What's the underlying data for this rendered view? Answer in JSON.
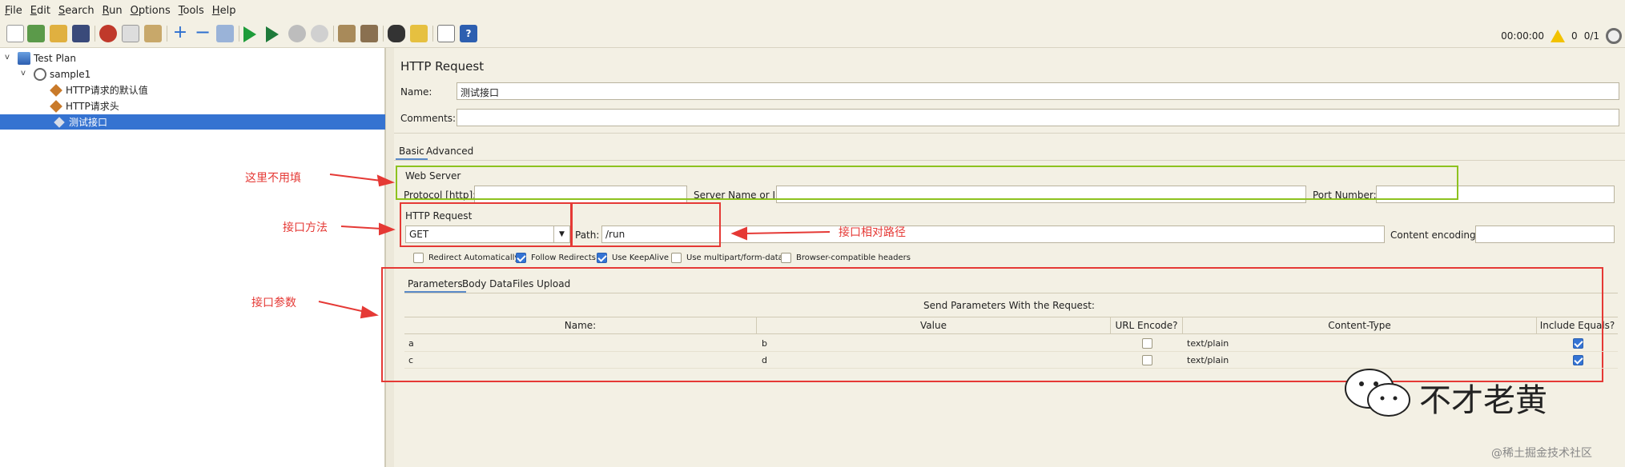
{
  "menu": [
    "File",
    "Edit",
    "Search",
    "Run",
    "Options",
    "Tools",
    "Help"
  ],
  "status": {
    "timer": "00:00:00",
    "warnings": "0",
    "threads": "0/1"
  },
  "tree": {
    "root": "Test Plan",
    "group": "sample1",
    "items": [
      "HTTP请求的默认值",
      "HTTP请求头",
      "测试接口"
    ]
  },
  "panel": {
    "title": "HTTP Request",
    "name_label": "Name:",
    "name_value": "测试接口",
    "comments_label": "Comments:",
    "tabs": [
      "Basic",
      "Advanced"
    ],
    "web_server": {
      "title": "Web Server",
      "protocol_label": "Protocol [http]:",
      "server_label": "Server Name or IP:",
      "port_label": "Port Number:"
    },
    "http_request": {
      "title": "HTTP Request",
      "method": "GET",
      "path_label": "Path:",
      "path_value": "/run",
      "encoding_label": "Content encoding:"
    },
    "options": [
      {
        "label": "Redirect Automatically",
        "checked": false
      },
      {
        "label": "Follow Redirects",
        "checked": true
      },
      {
        "label": "Use KeepAlive",
        "checked": true
      },
      {
        "label": "Use multipart/form-data",
        "checked": false
      },
      {
        "label": "Browser-compatible headers",
        "checked": false
      }
    ],
    "param_tabs": [
      "Parameters",
      "Body Data",
      "Files Upload"
    ],
    "send_title": "Send Parameters With the Request:",
    "columns": [
      "Name:",
      "Value",
      "URL Encode?",
      "Content-Type",
      "Include Equals?"
    ],
    "rows": [
      {
        "name": "a",
        "value": "b",
        "url_encode": false,
        "content_type": "text/plain",
        "include_equals": true
      },
      {
        "name": "c",
        "value": "d",
        "url_encode": false,
        "content_type": "text/plain",
        "include_equals": true
      }
    ]
  },
  "annotations": {
    "no_fill": "这里不用填",
    "method": "接口方法",
    "path": "接口相对路径",
    "params": "接口参数"
  },
  "watermark": "不才老黄",
  "credit": "@稀土掘金技术社区",
  "colors": {
    "annotation": "#e53935",
    "highlight": "#8dc21f",
    "selection": "#3573d1"
  }
}
